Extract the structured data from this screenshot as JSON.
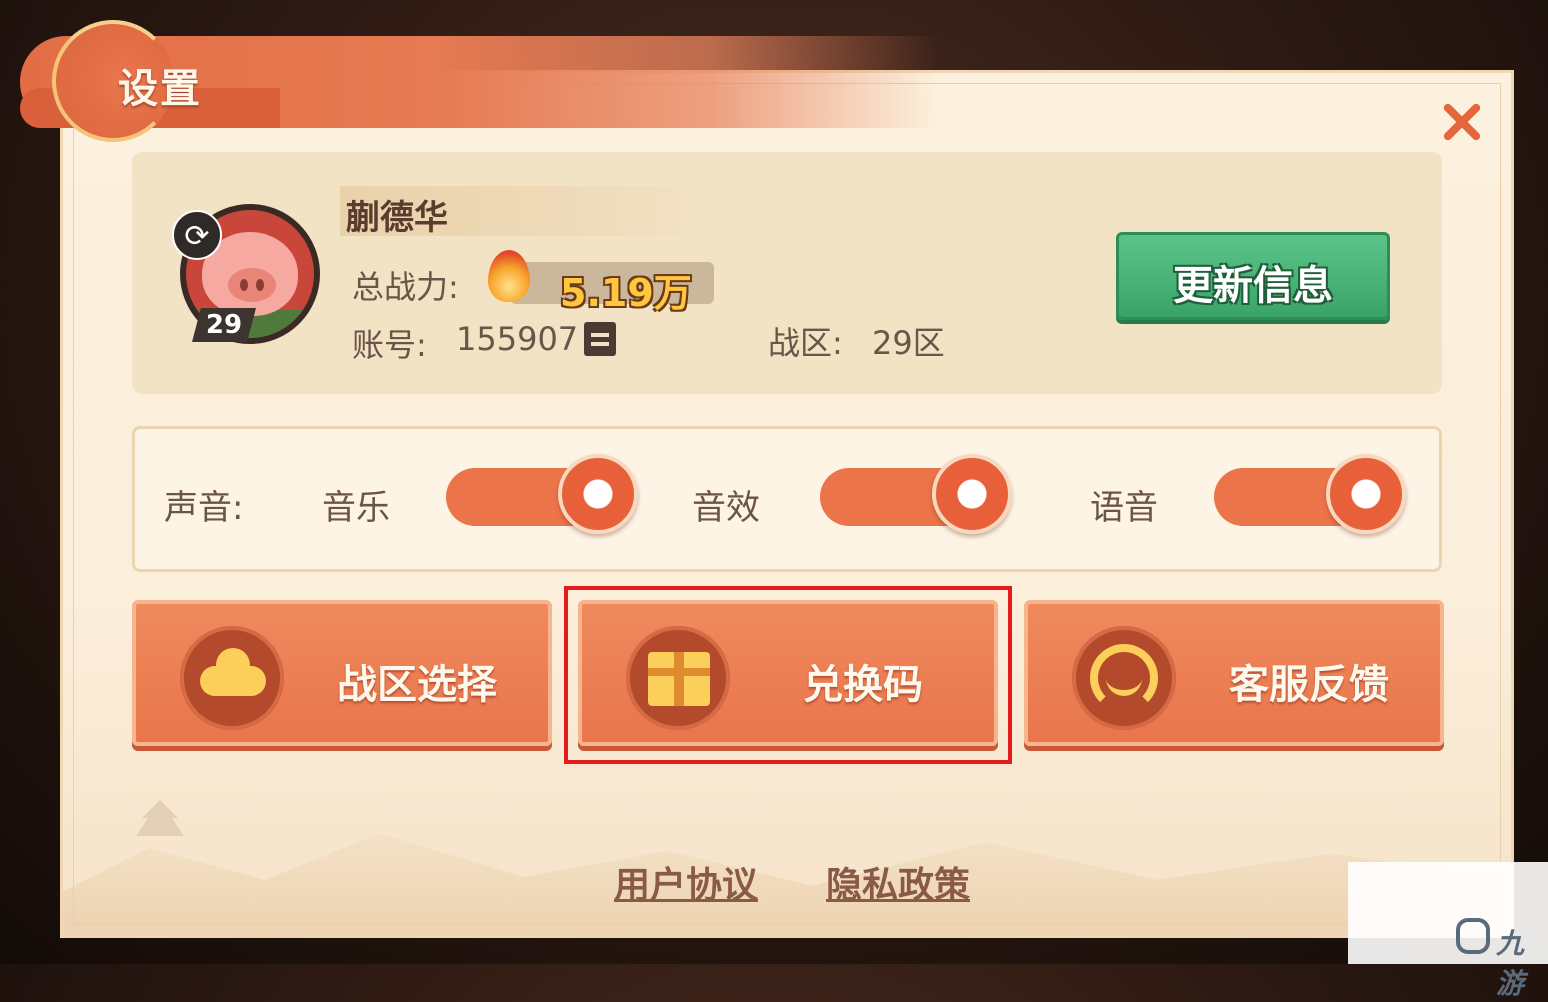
{
  "dialog": {
    "title": "设置"
  },
  "profile": {
    "name": "蒯德华",
    "level": "29",
    "power_label": "总战力:",
    "power_value": "5.19万",
    "account_label": "账号:",
    "account_value": "155907",
    "zone_label": "战区:",
    "zone_value": "29区",
    "update_button": "更新信息"
  },
  "sound": {
    "label": "声音:",
    "music_label": "音乐",
    "effects_label": "音效",
    "voice_label": "语音",
    "music_on": true,
    "effects_on": true,
    "voice_on": true
  },
  "actions": [
    {
      "label": "战区选择",
      "icon": "cloud-icon"
    },
    {
      "label": "兑换码",
      "icon": "gift-icon"
    },
    {
      "label": "客服反馈",
      "icon": "headset-icon"
    }
  ],
  "footer": {
    "user_agreement": "用户协议",
    "privacy_policy": "隐私政策"
  },
  "watermark": {
    "text": "九游"
  },
  "colors": {
    "accent": "#e9754b",
    "update_green": "#3aa468",
    "highlight_red": "#e41a1c",
    "panel_bg": "#fbeedb"
  }
}
